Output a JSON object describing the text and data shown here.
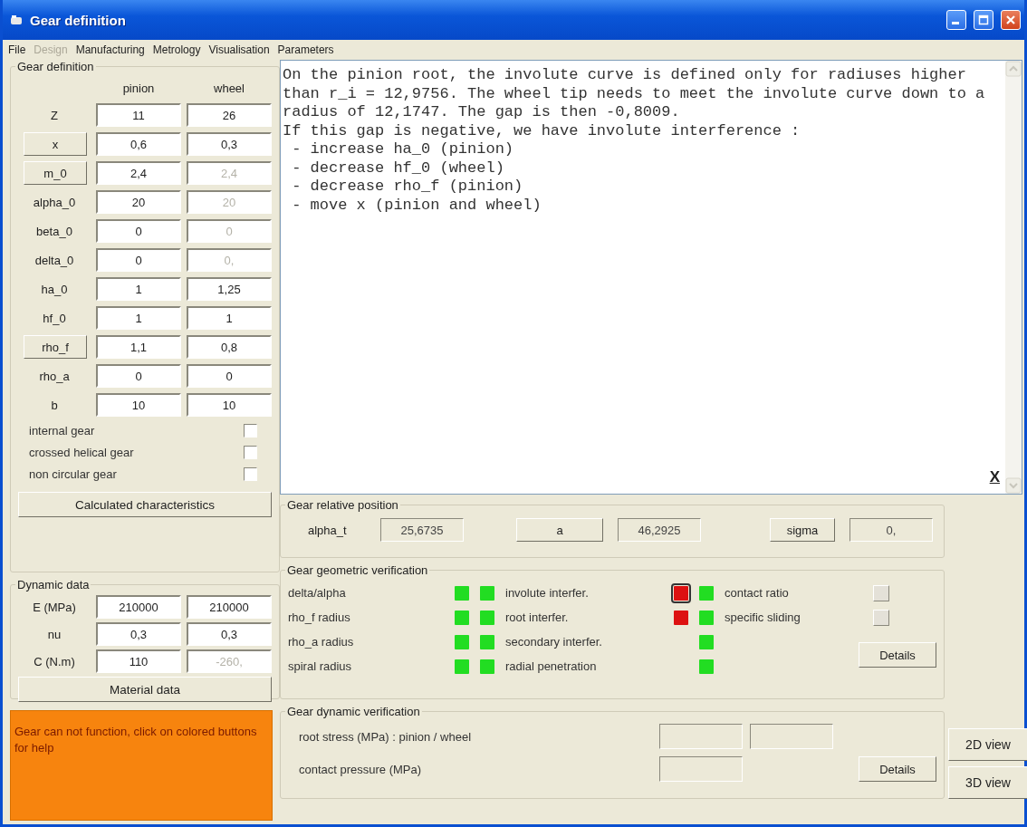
{
  "window": {
    "title": "Gear definition"
  },
  "menu": [
    {
      "label": "File",
      "disabled": false
    },
    {
      "label": "Design",
      "disabled": true
    },
    {
      "label": "Manufacturing",
      "disabled": false
    },
    {
      "label": "Metrology",
      "disabled": false
    },
    {
      "label": "Visualisation",
      "disabled": false
    },
    {
      "label": "Parameters",
      "disabled": false
    }
  ],
  "gear_definition": {
    "title": "Gear definition",
    "columns": [
      "pinion",
      "wheel"
    ],
    "rows": [
      {
        "label": "Z",
        "kind": "label",
        "pinion": {
          "value": "11",
          "disabled": false
        },
        "wheel": {
          "value": "26",
          "disabled": false
        }
      },
      {
        "label": "x",
        "kind": "button",
        "pinion": {
          "value": "0,6",
          "disabled": false
        },
        "wheel": {
          "value": "0,3",
          "disabled": false
        }
      },
      {
        "label": "m_0",
        "kind": "button",
        "pinion": {
          "value": "2,4",
          "disabled": false
        },
        "wheel": {
          "value": "2,4",
          "disabled": true
        }
      },
      {
        "label": "alpha_0",
        "kind": "label",
        "pinion": {
          "value": "20",
          "disabled": false
        },
        "wheel": {
          "value": "20",
          "disabled": true
        }
      },
      {
        "label": "beta_0",
        "kind": "label",
        "pinion": {
          "value": "0",
          "disabled": false
        },
        "wheel": {
          "value": "0",
          "disabled": true
        }
      },
      {
        "label": "delta_0",
        "kind": "label",
        "pinion": {
          "value": "0",
          "disabled": false
        },
        "wheel": {
          "value": "0,",
          "disabled": true
        }
      },
      {
        "label": "ha_0",
        "kind": "label",
        "pinion": {
          "value": "1",
          "disabled": false
        },
        "wheel": {
          "value": "1,25",
          "disabled": false
        }
      },
      {
        "label": "hf_0",
        "kind": "label",
        "pinion": {
          "value": "1",
          "disabled": false
        },
        "wheel": {
          "value": "1",
          "disabled": false
        }
      },
      {
        "label": "rho_f",
        "kind": "button",
        "pinion": {
          "value": "1,1",
          "disabled": false
        },
        "wheel": {
          "value": "0,8",
          "disabled": false
        }
      },
      {
        "label": "rho_a",
        "kind": "label",
        "pinion": {
          "value": "0",
          "disabled": false
        },
        "wheel": {
          "value": "0",
          "disabled": false
        }
      },
      {
        "label": "b",
        "kind": "label",
        "pinion": {
          "value": "10",
          "disabled": false
        },
        "wheel": {
          "value": "10",
          "disabled": false
        }
      }
    ],
    "options": [
      {
        "label": "internal gear",
        "checked": false
      },
      {
        "label": "crossed helical gear",
        "checked": false
      },
      {
        "label": "non circular gear",
        "checked": false
      }
    ],
    "button": "Calculated characteristics"
  },
  "dynamic_data": {
    "title": "Dynamic data",
    "rows": [
      {
        "label": "E (MPa)",
        "kind": "label",
        "pinion": {
          "value": "210000",
          "disabled": false
        },
        "wheel": {
          "value": "210000",
          "disabled": false
        }
      },
      {
        "label": "nu",
        "kind": "label",
        "pinion": {
          "value": "0,3",
          "disabled": false
        },
        "wheel": {
          "value": "0,3",
          "disabled": false
        }
      },
      {
        "label": "C (N.m)",
        "kind": "label",
        "pinion": {
          "value": "110",
          "disabled": false
        },
        "wheel": {
          "value": "-260,",
          "disabled": true
        }
      }
    ],
    "button": "Material data"
  },
  "status_message": "Gear can not function, click on colored buttons for help",
  "message": {
    "lines": [
      "On the pinion root, the involute curve is defined only for radiuses higher",
      "than r_i = 12,9756. The wheel tip needs to meet the involute curve down to a",
      "radius of 12,1747. The gap is then -0,8009.",
      "If this gap is negative, we have involute interference :",
      " - increase ha_0 (pinion)",
      " - decrease hf_0 (wheel)",
      " - decrease rho_f (pinion)",
      " - move x (pinion and wheel)"
    ],
    "close_button": "X"
  },
  "relative_position": {
    "title": "Gear relative position",
    "items": [
      {
        "kind": "label",
        "text": "alpha_t"
      },
      {
        "kind": "field",
        "text": "25,6735"
      },
      {
        "kind": "button",
        "text": "a"
      },
      {
        "kind": "field",
        "text": "46,2925"
      },
      {
        "kind": "button",
        "text": "sigma"
      },
      {
        "kind": "field",
        "text": "0,"
      }
    ]
  },
  "geometric_verification": {
    "title": "Gear geometric verification",
    "columns": [
      [
        {
          "label": "delta/alpha",
          "indicators": [
            {
              "color": "#22dd22",
              "focused": false
            },
            {
              "color": "#22dd22",
              "focused": false
            }
          ]
        },
        {
          "label": "rho_f radius",
          "indicators": [
            {
              "color": "#22dd22",
              "focused": false
            },
            {
              "color": "#22dd22",
              "focused": false
            }
          ]
        },
        {
          "label": "rho_a radius",
          "indicators": [
            {
              "color": "#22dd22",
              "focused": false
            },
            {
              "color": "#22dd22",
              "focused": false
            }
          ]
        },
        {
          "label": "spiral radius",
          "indicators": [
            {
              "color": "#22dd22",
              "focused": false
            },
            {
              "color": "#22dd22",
              "focused": false
            }
          ]
        }
      ],
      [
        {
          "label": "involute interfer.",
          "indicators": [
            {
              "color": "#dd1111",
              "focused": true
            },
            {
              "color": "#22dd22",
              "focused": false
            }
          ]
        },
        {
          "label": "root interfer.",
          "indicators": [
            {
              "color": "#dd1111",
              "focused": false
            },
            {
              "color": "#22dd22",
              "focused": false
            }
          ]
        },
        {
          "label": "secondary interfer.",
          "indicators": [
            {
              "color": "#22dd22",
              "focused": false
            }
          ]
        },
        {
          "label": "radial penetration",
          "indicators": [
            {
              "color": "#22dd22",
              "focused": false
            }
          ]
        }
      ],
      [
        {
          "label": "contact ratio",
          "indicators": [
            {
              "color": "#e4e1d8",
              "focused": false
            }
          ]
        },
        {
          "label": "specific sliding",
          "indicators": [
            {
              "color": "#e4e1d8",
              "focused": false
            }
          ]
        }
      ]
    ],
    "details_button": "Details"
  },
  "dynamic_verification": {
    "title": "Gear dynamic verification",
    "rows": [
      {
        "label": "root stress (MPa) : pinion / wheel",
        "fields": [
          {
            "kind": "output"
          },
          {
            "kind": "output"
          }
        ]
      },
      {
        "label": "contact pressure (MPa)",
        "fields": [
          {
            "kind": "output"
          }
        ],
        "button": "Details"
      }
    ]
  },
  "view_buttons": [
    "2D view",
    "3D view"
  ]
}
